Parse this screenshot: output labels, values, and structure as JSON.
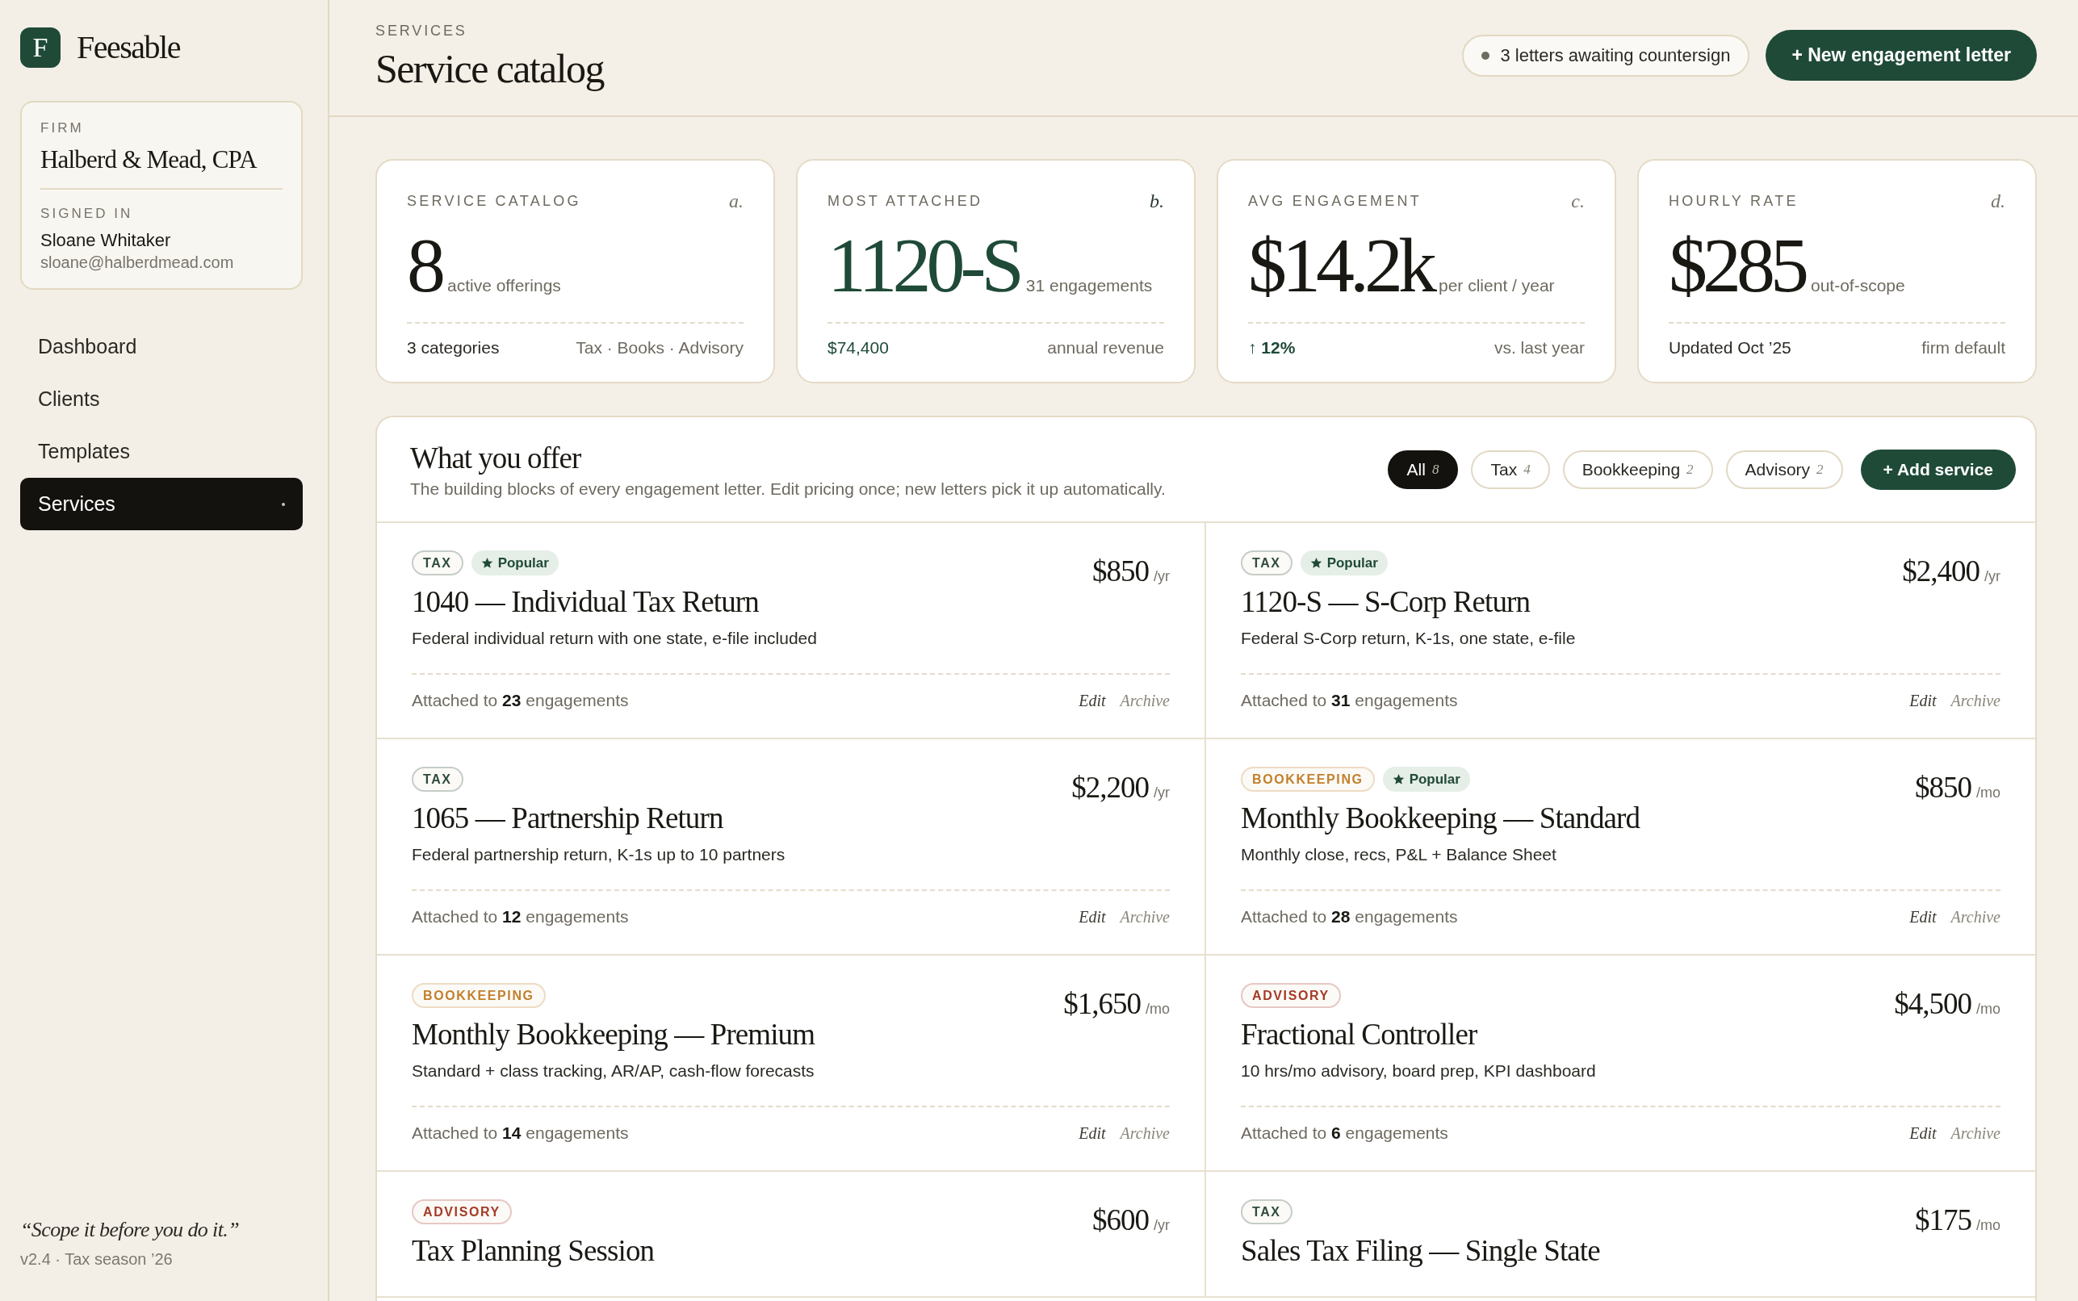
{
  "sidebar": {
    "brand": {
      "mark": "F",
      "name": "Feesable"
    },
    "firm": {
      "label": "FIRM",
      "name": "Halberd & Mead, CPA",
      "signed_in_label": "SIGNED IN",
      "user_name": "Sloane Whitaker",
      "email": "sloane@halberdmead.com"
    },
    "nav": [
      {
        "label": "Dashboard",
        "selected": false
      },
      {
        "label": "Clients",
        "selected": false
      },
      {
        "label": "Templates",
        "selected": false
      },
      {
        "label": "Services",
        "selected": true
      }
    ],
    "quote": "“Scope it before you do it.”",
    "version": "v2.4 · Tax season ’26"
  },
  "header": {
    "eyebrow": "SERVICES",
    "title": "Service catalog",
    "status": "3 letters awaiting countersign",
    "primary_action": "+ New engagement letter"
  },
  "stats": [
    {
      "kind": "plain",
      "label": "SERVICE CATALOG",
      "letter": "a.",
      "value": "8",
      "unit": "active offerings",
      "foot_left": "3 categories",
      "foot_right": "Tax · Books · Advisory"
    },
    {
      "kind": "highlight",
      "label": "MOST ATTACHED",
      "letter": "b.",
      "value": "1120-S",
      "unit": "31 engagements",
      "foot_left": "$74,400",
      "foot_right": "annual revenue"
    },
    {
      "kind": "trend",
      "label": "AVG ENGAGEMENT",
      "letter": "c.",
      "value": "$14.2k",
      "unit": "per client / year",
      "foot_left": "↑ 12%",
      "foot_right": "vs. last year"
    },
    {
      "kind": "plain",
      "label": "HOURLY RATE",
      "letter": "d.",
      "value": "$285",
      "unit": "out-of-scope",
      "foot_left": "Updated Oct ’25",
      "foot_right": "firm default"
    }
  ],
  "services": {
    "title": "What you offer",
    "subtitle": "The building blocks of every engagement letter. Edit pricing once; new letters pick it up automatically.",
    "filters": [
      {
        "label": "All",
        "count": "8",
        "selected": true
      },
      {
        "label": "Tax",
        "count": "4",
        "selected": false
      },
      {
        "label": "Bookkeeping",
        "count": "2",
        "selected": false
      },
      {
        "label": "Advisory",
        "count": "2",
        "selected": false
      }
    ],
    "add_action": "+ Add service",
    "items": [
      {
        "tag": {
          "label": "TAX",
          "color": "#2f4b3e"
        },
        "badge": "Popular",
        "title": "1040 — Individual Tax Return",
        "price": "$850",
        "period": "/yr",
        "description": "Federal individual return with one state, e-file included",
        "attached": "Attached to **23** engagements",
        "actions": [
          "Edit",
          "Archive"
        ]
      },
      {
        "tag": {
          "label": "TAX",
          "color": "#2f4b3e"
        },
        "badge": "Popular",
        "title": "1120-S — S-Corp Return",
        "price": "$2,400",
        "period": "/yr",
        "description": "Federal S-Corp return, K-1s, one state, e-file",
        "attached": "Attached to **31** engagements",
        "actions": [
          "Edit",
          "Archive"
        ]
      },
      {
        "tag": {
          "label": "TAX",
          "color": "#2f4b3e"
        },
        "title": "1065 — Partnership Return",
        "price": "$2,200",
        "period": "/yr",
        "description": "Federal partnership return, K-1s up to 10 partners",
        "attached": "Attached to **12** engagements",
        "actions": [
          "Edit",
          "Archive"
        ]
      },
      {
        "tag": {
          "label": "BOOKKEEPING",
          "color": "#c2802e"
        },
        "badge": "Popular",
        "title": "Monthly Bookkeeping — Standard",
        "price": "$850",
        "period": "/mo",
        "description": "Monthly close, recs, P&L + Balance Sheet",
        "attached": "Attached to **28** engagements",
        "actions": [
          "Edit",
          "Archive"
        ]
      },
      {
        "tag": {
          "label": "BOOKKEEPING",
          "color": "#c2802e"
        },
        "title": "Monthly Bookkeeping — Premium",
        "price": "$1,650",
        "period": "/mo",
        "description": "Standard + class tracking, AR/AP, cash-flow forecasts",
        "attached": "Attached to **14** engagements",
        "actions": [
          "Edit",
          "Archive"
        ]
      },
      {
        "tag": {
          "label": "ADVISORY",
          "color": "#a53b27"
        },
        "title": "Fractional Controller",
        "price": "$4,500",
        "period": "/mo",
        "description": "10 hrs/mo advisory, board prep, KPI dashboard",
        "attached": "Attached to **6** engagements",
        "actions": [
          "Edit",
          "Archive"
        ]
      },
      {
        "tag": {
          "label": "ADVISORY",
          "color": "#a53b27"
        },
        "title": "Tax Planning Session",
        "price": "$600",
        "period": "/yr"
      },
      {
        "tag": {
          "label": "TAX",
          "color": "#2f4b3e"
        },
        "title": "Sales Tax Filing — Single State",
        "price": "$175",
        "period": "/mo"
      }
    ]
  }
}
